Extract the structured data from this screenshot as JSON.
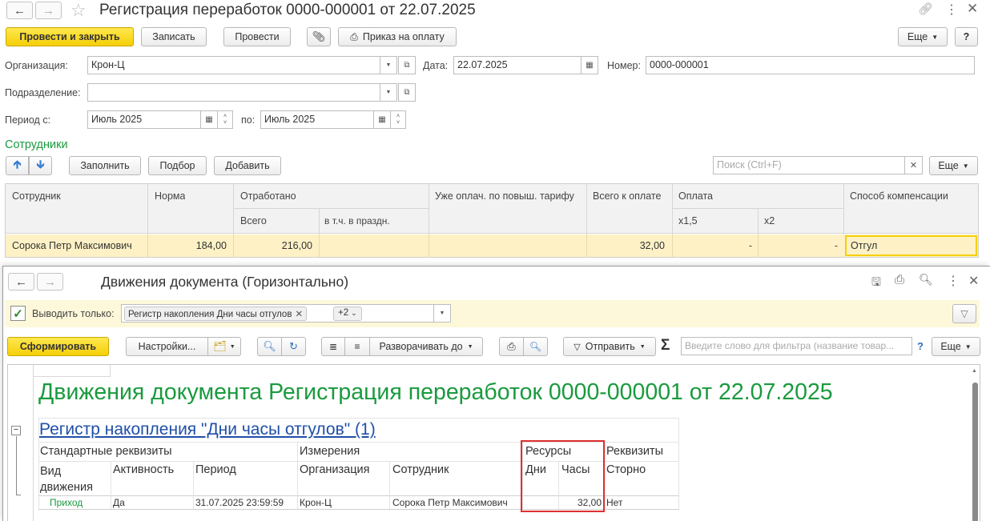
{
  "top_window": {
    "title": "Регистрация переработок 0000-000001 от 22.07.2025",
    "toolbar": {
      "post_close": "Провести и закрыть",
      "save": "Записать",
      "post": "Провести",
      "print_order": "Приказ на оплату",
      "more": "Еще",
      "help": "?"
    },
    "fields": {
      "org_label": "Организация:",
      "org_value": "Крон-Ц",
      "date_label": "Дата:",
      "date_value": "22.07.2025",
      "number_label": "Номер:",
      "number_value": "0000-000001",
      "dept_label": "Подразделение:",
      "dept_value": "",
      "period_label": "Период с:",
      "period_from": "Июль 2025",
      "period_to_label": "по:",
      "period_to": "Июль 2025"
    },
    "employees": {
      "section_title": "Сотрудники",
      "fill": "Заполнить",
      "pick": "Подбор",
      "add": "Добавить",
      "search_placeholder": "Поиск (Ctrl+F)",
      "more": "Еще",
      "columns": {
        "employee": "Сотрудник",
        "norm": "Норма",
        "worked": "Отработано",
        "worked_total": "Всего",
        "worked_holiday": "в т.ч. в праздн.",
        "already_paid": "Уже оплач. по повыш. тарифу",
        "total_pay": "Всего к оплате",
        "payment": "Оплата",
        "pay_x15": "x1,5",
        "pay_x2": "x2",
        "compensation": "Способ компенсации"
      },
      "rows": [
        {
          "employee": "Сорока Петр Максимович",
          "norm": "184,00",
          "worked_total": "216,00",
          "worked_holiday": "",
          "already_paid": "",
          "total_pay": "32,00",
          "pay_x15": "-",
          "pay_x2": "-",
          "compensation": "Отгул"
        }
      ]
    }
  },
  "bottom_window": {
    "title": "Движения документа (Горизонтально)",
    "filter": {
      "label": "Выводить только:",
      "tag": "Регистр накопления Дни часы отгулов",
      "more_count": "+2"
    },
    "toolbar": {
      "generate": "Сформировать",
      "settings": "Настройки...",
      "expand_to": "Разворачивать до",
      "send": "Отправить",
      "sigma": "Σ",
      "filter_placeholder": "Введите слово для фильтра (название товар...",
      "help": "?",
      "more": "Еще"
    },
    "report": {
      "title": "Движения документа Регистрация переработок 0000-000001 от 22.07.2025",
      "register_link": "Регистр накопления \"Дни часы отгулов\" (1)",
      "groups": {
        "standard": "Стандартные реквизиты",
        "dimensions": "Измерения",
        "resources": "Ресурсы",
        "attributes": "Реквизиты"
      },
      "columns": {
        "movement_type": "Вид движения",
        "activity": "Активность",
        "period": "Период",
        "organization": "Организация",
        "employee": "Сотрудник",
        "days": "Дни",
        "hours": "Часы",
        "storno": "Сторно"
      },
      "rows": [
        {
          "movement_type": "Приход",
          "activity": "Да",
          "period": "31.07.2025 23:59:59",
          "organization": "Крон-Ц",
          "employee": "Сорока Петр Максимович",
          "days": "",
          "hours": "32,00",
          "storno": "Нет"
        }
      ]
    }
  },
  "colors": {
    "accent_green": "#1a9a3e",
    "yellow_button": "#f5cf07",
    "highlight_red": "#e03030",
    "selected_row": "#fdf1c5"
  }
}
